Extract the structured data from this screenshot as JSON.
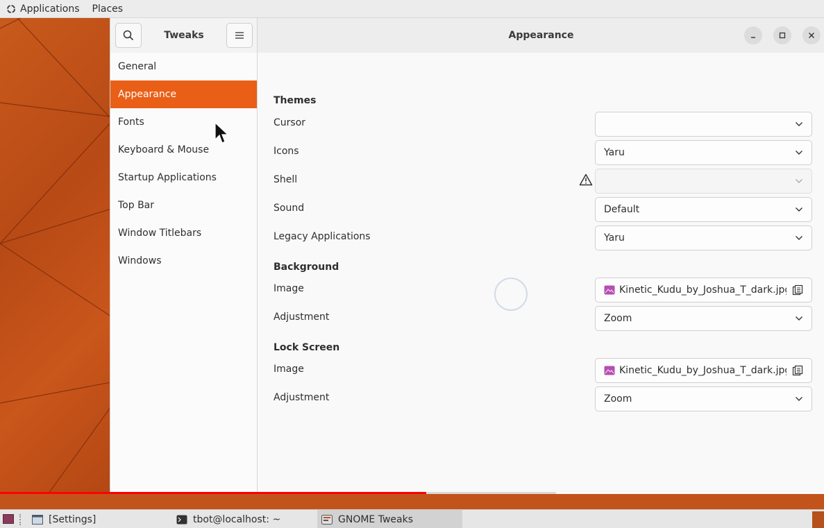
{
  "top_panel": {
    "applications_label": "Applications",
    "places_label": "Places"
  },
  "window": {
    "sidebar_title": "Tweaks",
    "page_title": "Appearance"
  },
  "sidebar": {
    "items": [
      {
        "label": "General",
        "active": false
      },
      {
        "label": "Appearance",
        "active": true
      },
      {
        "label": "Fonts",
        "active": false
      },
      {
        "label": "Keyboard & Mouse",
        "active": false
      },
      {
        "label": "Startup Applications",
        "active": false
      },
      {
        "label": "Top Bar",
        "active": false
      },
      {
        "label": "Window Titlebars",
        "active": false
      },
      {
        "label": "Windows",
        "active": false
      }
    ]
  },
  "themes": {
    "title": "Themes",
    "cursor": {
      "label": "Cursor",
      "value": ""
    },
    "icons": {
      "label": "Icons",
      "value": "Yaru"
    },
    "shell": {
      "label": "Shell",
      "value": ""
    },
    "sound": {
      "label": "Sound",
      "value": "Default"
    },
    "legacy": {
      "label": "Legacy Applications",
      "value": "Yaru"
    }
  },
  "background": {
    "title": "Background",
    "image": {
      "label": "Image",
      "value": "Kinetic_Kudu_by_Joshua_T_dark.jpg"
    },
    "adjustment": {
      "label": "Adjustment",
      "value": "Zoom"
    }
  },
  "lock_screen": {
    "title": "Lock Screen",
    "image": {
      "label": "Image",
      "value": "Kinetic_Kudu_by_Joshua_T_dark.jpg"
    },
    "adjustment": {
      "label": "Adjustment",
      "value": "Zoom"
    }
  },
  "video_progress": {
    "played_fraction": 0.517,
    "buffered_fraction": 0.675
  },
  "taskbar": {
    "items": [
      {
        "label": "[Settings]",
        "active": false
      },
      {
        "label": "tbot@localhost: ~",
        "active": false
      },
      {
        "label": "GNOME Tweaks",
        "active": true
      }
    ]
  },
  "colors": {
    "accent": "#e95f17",
    "wallpaper": "#c2541b",
    "progress_played": "#ff0000"
  }
}
